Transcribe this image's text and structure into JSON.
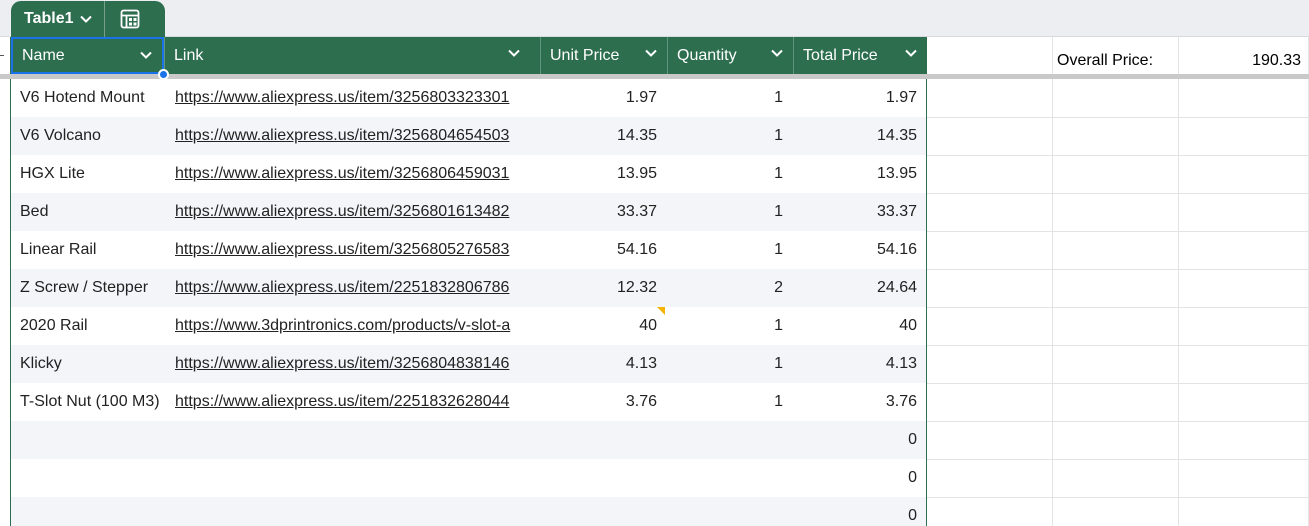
{
  "table": {
    "name": "Table1",
    "columns": [
      {
        "label": "Name"
      },
      {
        "label": "Link"
      },
      {
        "label": "Unit Price"
      },
      {
        "label": "Quantity"
      },
      {
        "label": "Total Price"
      }
    ],
    "rows": [
      {
        "name": "V6 Hotend Mount",
        "link": "https://www.aliexpress.us/item/3256803323301",
        "unit": "1.97",
        "qty": "1",
        "total": "1.97"
      },
      {
        "name": "V6 Volcano",
        "link": "https://www.aliexpress.us/item/3256804654503",
        "unit": "14.35",
        "qty": "1",
        "total": "14.35"
      },
      {
        "name": "HGX Lite",
        "link": "https://www.aliexpress.us/item/3256806459031",
        "unit": "13.95",
        "qty": "1",
        "total": "13.95"
      },
      {
        "name": "Bed",
        "link": "https://www.aliexpress.us/item/3256801613482",
        "unit": "33.37",
        "qty": "1",
        "total": "33.37"
      },
      {
        "name": "Linear Rail",
        "link": "https://www.aliexpress.us/item/3256805276583",
        "unit": "54.16",
        "qty": "1",
        "total": "54.16"
      },
      {
        "name": "Z Screw / Stepper",
        "link": "https://www.aliexpress.us/item/2251832806786",
        "unit": "12.32",
        "qty": "2",
        "total": "24.64"
      },
      {
        "name": "2020 Rail",
        "link": "https://www.3dprintronics.com/products/v-slot-a",
        "unit": "40",
        "qty": "1",
        "total": "40",
        "has_note": true
      },
      {
        "name": "Klicky",
        "link": "https://www.aliexpress.us/item/3256804838146",
        "unit": "4.13",
        "qty": "1",
        "total": "4.13"
      },
      {
        "name": "T-Slot Nut (100 M3)",
        "link": "https://www.aliexpress.us/item/2251832628044",
        "unit": "3.76",
        "qty": "1",
        "total": "3.76"
      },
      {
        "name": "",
        "link": "",
        "unit": "",
        "qty": "",
        "total": "0"
      },
      {
        "name": "",
        "link": "",
        "unit": "",
        "qty": "",
        "total": "0"
      },
      {
        "name": "",
        "link": "",
        "unit": "",
        "qty": "",
        "total": "0"
      }
    ]
  },
  "summary": {
    "label": "Overall Price:",
    "value": "190.33"
  },
  "colors": {
    "header_bg": "#2d6e4f",
    "selection": "#1a73e8",
    "note_marker": "#f4b400",
    "alt_row": "#f3f5f8"
  },
  "icons": {
    "dropdown": "chevron-down-icon",
    "table_menu": "table-calculator-icon"
  }
}
